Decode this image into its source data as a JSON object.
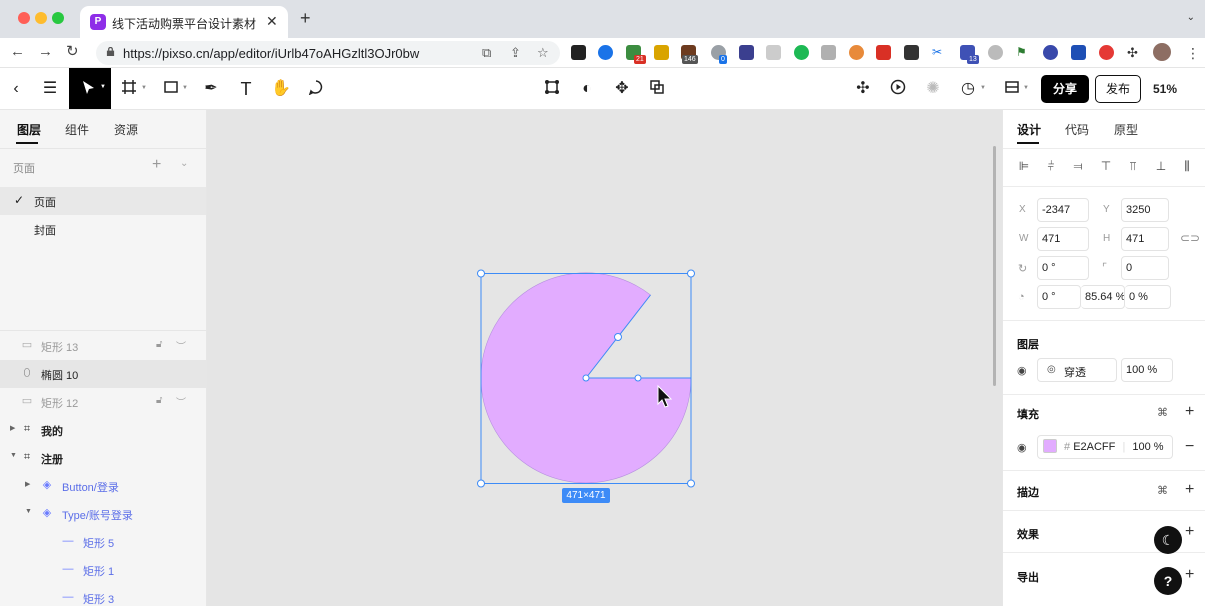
{
  "browser": {
    "tab_title": "线下活动购票平台设计素材（来自",
    "tab_favicon": "P",
    "url": "https://pixso.cn/app/editor/iUrlb47oAHGzltl3OJr0bw",
    "ext_badges": [
      "21",
      "146",
      "0",
      "13"
    ]
  },
  "toolbar": {
    "share_label": "分享",
    "publish_label": "发布",
    "zoom": "51%"
  },
  "left_panel": {
    "tabs": [
      "图层",
      "组件",
      "资源"
    ],
    "pages_header": "页面",
    "pages": [
      "页面",
      "封面"
    ],
    "layers": [
      {
        "label": "矩形 13",
        "muted": true
      },
      {
        "label": "椭圆 10",
        "selected": true
      },
      {
        "label": "矩形 12",
        "muted": true
      },
      {
        "label": "我的"
      },
      {
        "label": "注册"
      },
      {
        "label": "Button/登录"
      },
      {
        "label": "Type/账号登录"
      },
      {
        "label": "矩形 5"
      },
      {
        "label": "矩形 1"
      },
      {
        "label": "矩形 3"
      }
    ]
  },
  "canvas": {
    "size_label": "471×471",
    "fill_color": "#E2ACFF",
    "selection_color": "#3d8bf7"
  },
  "right_panel": {
    "tabs": [
      "设计",
      "代码",
      "原型"
    ],
    "labels": {
      "x": "X",
      "y": "Y",
      "w": "W",
      "h": "H"
    },
    "x": "-2347",
    "y": "3250",
    "w": "471",
    "h": "471",
    "rotation": "0 °",
    "corner_radius": "0",
    "arc_start": "0 °",
    "arc_sweep": "85.64 %",
    "arc_ratio": "0 %",
    "layer_section": "图层",
    "blend_mode": "穿透",
    "opacity": "100 %",
    "fill_section": "填充",
    "fill_hex": "E2ACFF",
    "fill_opacity": "100 %",
    "stroke_section": "描边",
    "effect_section": "效果",
    "export_section": "导出"
  }
}
